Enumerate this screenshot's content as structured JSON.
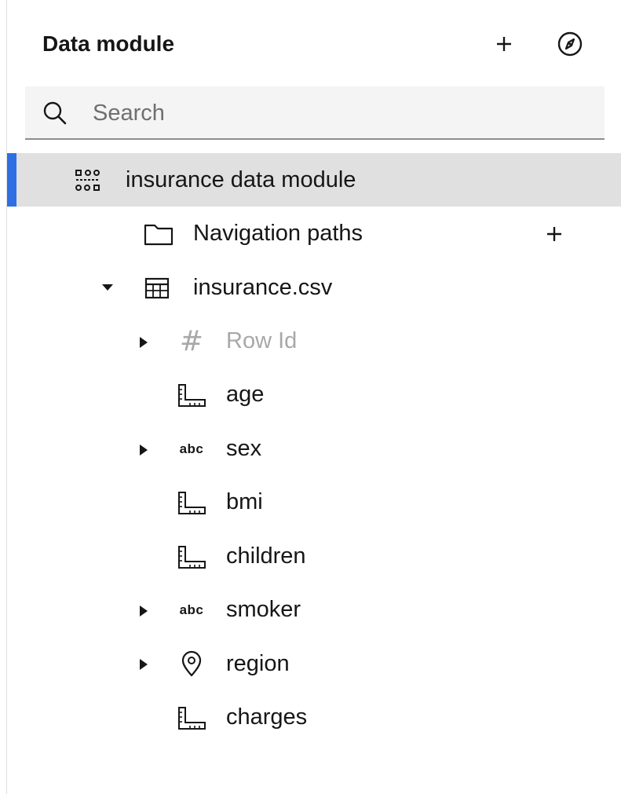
{
  "header": {
    "title": "Data module"
  },
  "search": {
    "placeholder": "Search",
    "value": ""
  },
  "tree": {
    "module": {
      "label": "insurance data module",
      "selected": true
    },
    "navigation_paths": {
      "label": "Navigation paths"
    },
    "table": {
      "label": "insurance.csv",
      "expanded": true
    },
    "columns": [
      {
        "label": "Row Id",
        "type": "identifier",
        "icon": "hash-icon",
        "expandable": true,
        "muted": true
      },
      {
        "label": "age",
        "type": "measure",
        "icon": "ruler-icon",
        "expandable": false
      },
      {
        "label": "sex",
        "type": "text",
        "icon": "abc-icon",
        "icon_text": "abc",
        "expandable": true
      },
      {
        "label": "bmi",
        "type": "measure",
        "icon": "ruler-icon",
        "expandable": false
      },
      {
        "label": "children",
        "type": "measure",
        "icon": "ruler-icon",
        "expandable": false
      },
      {
        "label": "smoker",
        "type": "text",
        "icon": "abc-icon",
        "icon_text": "abc",
        "expandable": true
      },
      {
        "label": "region",
        "type": "location",
        "icon": "location-pin-icon",
        "expandable": true
      },
      {
        "label": "charges",
        "type": "measure",
        "icon": "ruler-icon",
        "expandable": false
      }
    ]
  },
  "colors": {
    "selected_row_bg": "#e0e0e0",
    "selected_indicator": "#2f6fe4",
    "muted_text": "#a8a8a8"
  }
}
